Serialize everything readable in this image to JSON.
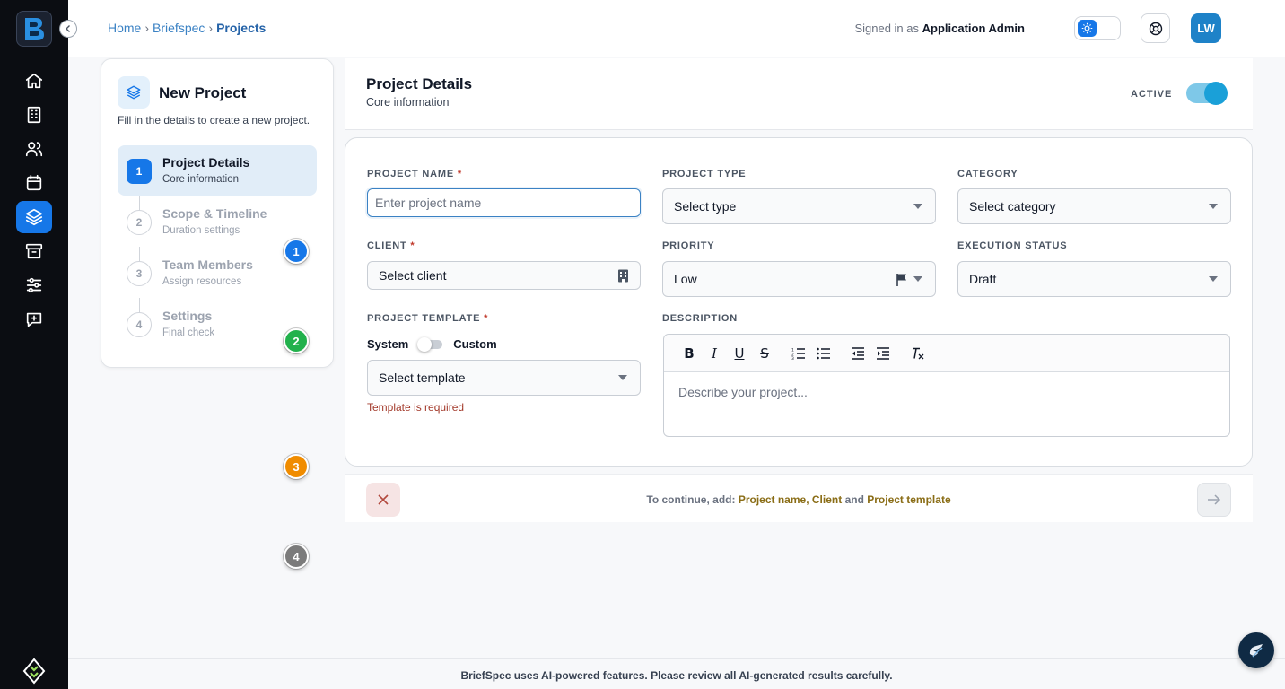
{
  "header": {
    "breadcrumb": [
      "Home",
      "Briefspec",
      "Projects"
    ],
    "signed_in_prefix": "Signed in as",
    "signed_in_user": "Application Admin",
    "avatar_initials": "LW"
  },
  "sidebar": {
    "items": [
      {
        "name": "home",
        "icon": "home-icon",
        "active": false
      },
      {
        "name": "buildings",
        "icon": "building-icon",
        "active": false
      },
      {
        "name": "users",
        "icon": "users-icon",
        "active": false
      },
      {
        "name": "calendar",
        "icon": "calendar-icon",
        "active": false
      },
      {
        "name": "projects",
        "icon": "layers-icon",
        "active": true
      },
      {
        "name": "archive",
        "icon": "archive-icon",
        "active": false
      },
      {
        "name": "settings",
        "icon": "sliders-icon",
        "active": false
      },
      {
        "name": "feedback",
        "icon": "message-plus-icon",
        "active": false
      }
    ]
  },
  "wizard": {
    "title": "New Project",
    "subtitle": "Fill in the details to create a new project.",
    "steps": [
      {
        "num": "1",
        "title": "Project Details",
        "sub": "Core information",
        "active": true
      },
      {
        "num": "2",
        "title": "Scope & Timeline",
        "sub": "Duration settings",
        "active": false
      },
      {
        "num": "3",
        "title": "Team Members",
        "sub": "Assign resources",
        "active": false
      },
      {
        "num": "4",
        "title": "Settings",
        "sub": "Final check",
        "active": false
      }
    ]
  },
  "badges": [
    "1",
    "2",
    "3",
    "4"
  ],
  "badge_colors": [
    "#1677e8",
    "#22b14c",
    "#f08c00",
    "#7b7b7b"
  ],
  "panel": {
    "title": "Project Details",
    "subtitle": "Core information",
    "active_label": "ACTIVE",
    "active": true
  },
  "form": {
    "project_name": {
      "label": "PROJECT NAME",
      "placeholder": "Enter project name"
    },
    "project_type": {
      "label": "PROJECT TYPE",
      "value": "Select type"
    },
    "category": {
      "label": "CATEGORY",
      "value": "Select category"
    },
    "client": {
      "label": "CLIENT",
      "value": "Select client"
    },
    "priority": {
      "label": "PRIORITY",
      "value": "Low"
    },
    "execution_status": {
      "label": "EXECUTION STATUS",
      "value": "Draft"
    },
    "project_template": {
      "label": "PROJECT TEMPLATE",
      "toggle_left": "System",
      "toggle_right": "Custom",
      "value": "Select template",
      "error": "Template is required"
    },
    "description": {
      "label": "DESCRIPTION",
      "placeholder": "Describe your project..."
    },
    "required_mark": "*"
  },
  "action_bar": {
    "prefix": "To continue, add:",
    "missing_1": "Project name,",
    "missing_2": "Client",
    "and": "and",
    "missing_3": "Project template"
  },
  "footer": {
    "notice": "BriefSpec uses AI-powered features. Please review all AI-generated results carefully."
  },
  "colors": {
    "accent": "#1677e8",
    "sidebar_bg": "#0b0d12",
    "error": "#a33a2b",
    "highlight": "#8a6d16"
  }
}
